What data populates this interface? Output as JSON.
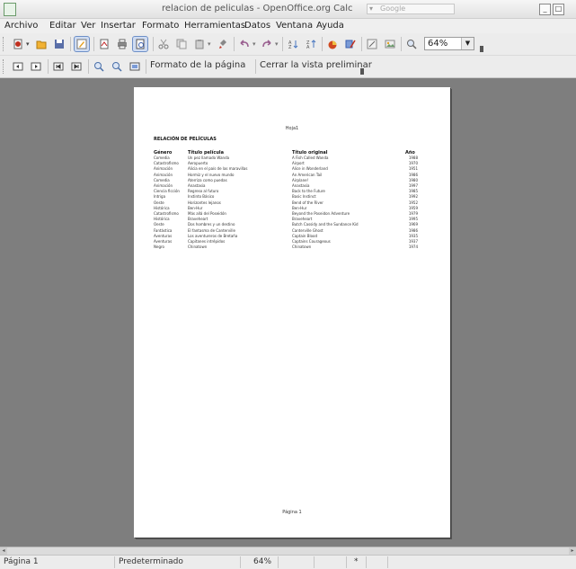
{
  "window": {
    "title": "relacion de peliculas - OpenOffice.org Calc",
    "search_placeholder": "Google",
    "minimize_glyph": "_",
    "maximize_glyph": "□"
  },
  "menu": [
    "Archivo",
    "Editar",
    "Ver",
    "Insertar",
    "Formato",
    "Herramientas",
    "Datos",
    "Ventana",
    "Ayuda"
  ],
  "toolbar": {
    "zoom_value": "64%",
    "page_format_label": "Formato de la página",
    "close_preview_label": "Cerrar la vista preliminar"
  },
  "page": {
    "header": "Hoja1",
    "footer": "Página 1",
    "sheet_title": "RELACIÓN DE PELÍCULAS",
    "columns": [
      "Género",
      "Título película",
      "Título original",
      "Año"
    ],
    "rows": [
      [
        "Comedia",
        "Un pez llamado Wanda",
        "A Fish Called Wanda",
        "1988"
      ],
      [
        "Catastrofismo",
        "Aeropuerto",
        "Airport",
        "1970"
      ],
      [
        "Animación",
        "Alicia en el país de las maravillas",
        "Alice in Wonderland",
        "1951"
      ],
      [
        "Animación",
        "Hormiz y el nuevo mundo",
        "An American Tail",
        "1986"
      ],
      [
        "Comedia",
        "Aterriza como puedas",
        "Airplane!",
        "1980"
      ],
      [
        "Animación",
        "Anastasia",
        "Anastasia",
        "1997"
      ],
      [
        "Ciencia ficción",
        "Regreso al futuro",
        "Back to the Future",
        "1985"
      ],
      [
        "Intriga",
        "Instinto Básico",
        "Basic Instinct",
        "1992"
      ],
      [
        "Oeste",
        "Horizontes lejanos",
        "Bend of the River",
        "1952"
      ],
      [
        "Histórica",
        "Ben-Hur",
        "Ben-Hur",
        "1959"
      ],
      [
        "Catastrofismo",
        "Más allá del Poseidón",
        "Beyond the Poseidon Adventure",
        "1979"
      ],
      [
        "Histórica",
        "Braveheart",
        "Braveheart",
        "1995"
      ],
      [
        "Oeste",
        "Dos hombres y un destino",
        "Butch Cassidy and the Sundance Kid",
        "1969"
      ],
      [
        "Fantástica",
        "El fantasma de Canterville",
        "Canterville Ghost",
        "1986"
      ],
      [
        "Aventuras",
        "Los aventureros de Bretaña",
        "Captain Blood",
        "1935"
      ],
      [
        "Aventuras",
        "Capitanes intrépidos",
        "Captains Courageous",
        "1937"
      ],
      [
        "Negro",
        "Chinatown",
        "Chinatown",
        "1974"
      ]
    ]
  },
  "status": {
    "page": "Página 1",
    "style": "Predeterminado",
    "zoom": "64%",
    "modified": "*"
  }
}
